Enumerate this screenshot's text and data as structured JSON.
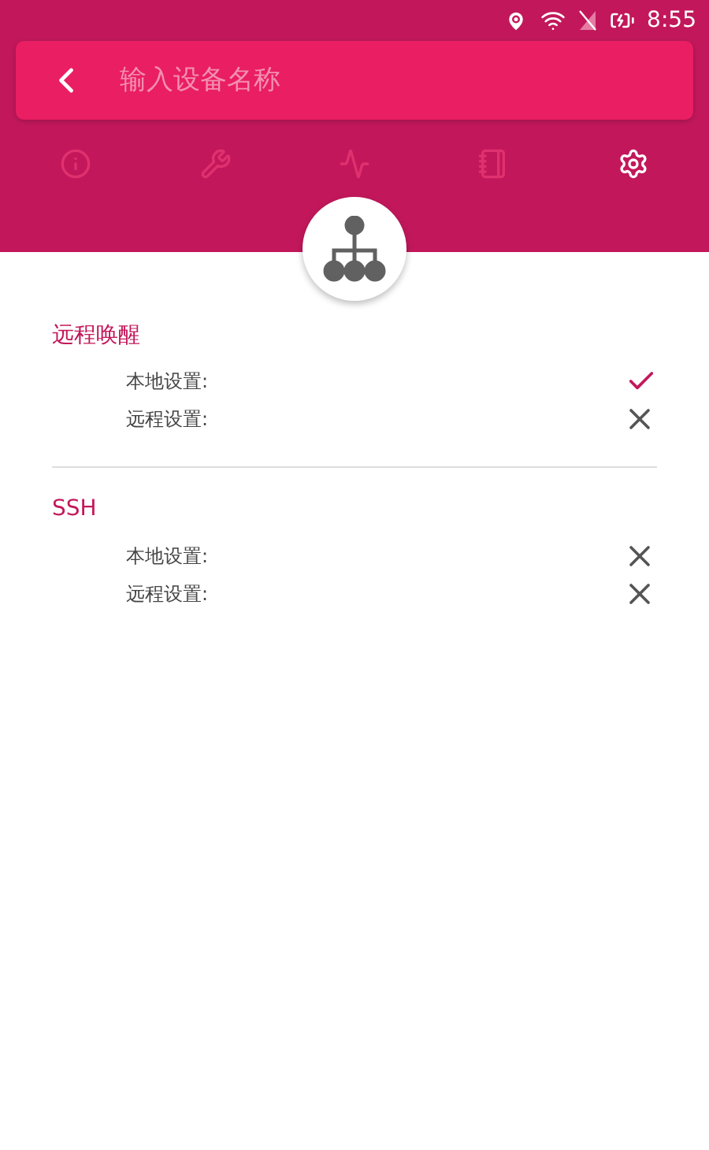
{
  "status_bar": {
    "time": "8:55"
  },
  "search": {
    "placeholder": "输入设备名称"
  },
  "tabs": [
    {
      "kind": "info",
      "selected": false
    },
    {
      "kind": "tools",
      "selected": false
    },
    {
      "kind": "monitor",
      "selected": false
    },
    {
      "kind": "notebook",
      "selected": false
    },
    {
      "kind": "settings",
      "selected": true
    }
  ],
  "sections": [
    {
      "title": "远程唤醒",
      "rows": [
        {
          "label": "本地设置:",
          "enabled": true
        },
        {
          "label": "远程设置:",
          "enabled": false
        }
      ]
    },
    {
      "title": "SSH",
      "rows": [
        {
          "label": "本地设置:",
          "enabled": false
        },
        {
          "label": "远程设置:",
          "enabled": false
        }
      ]
    }
  ]
}
